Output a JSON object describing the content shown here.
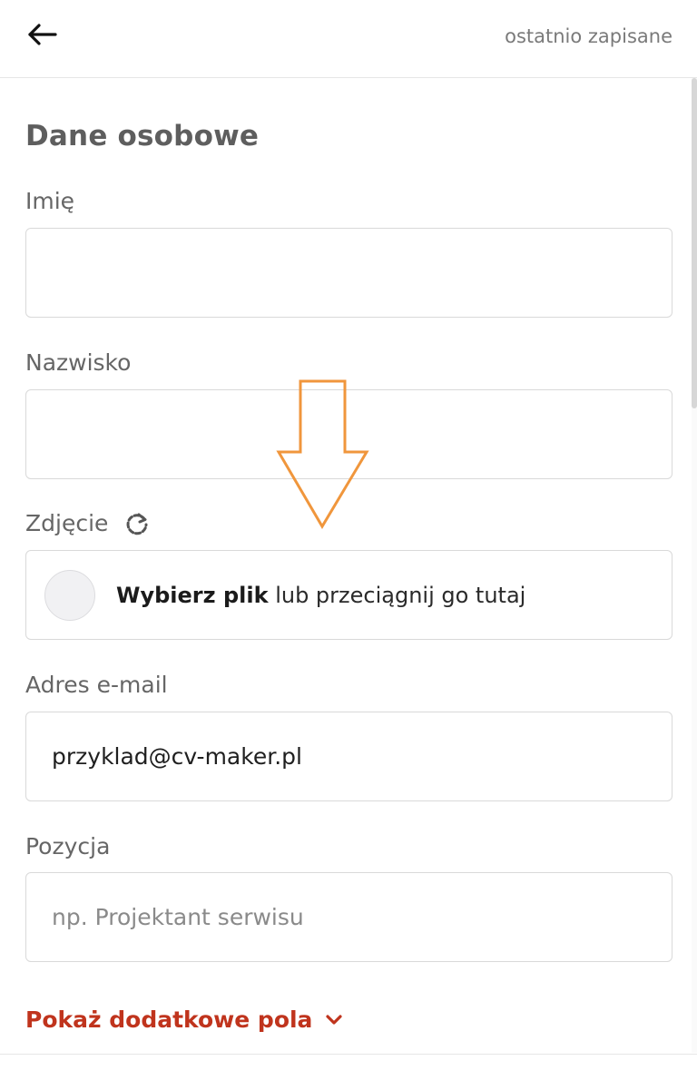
{
  "header": {
    "save_status": "ostatnio zapisane"
  },
  "section": {
    "title": "Dane osobowe"
  },
  "fields": {
    "first_name": {
      "label": "Imię",
      "value": "",
      "placeholder": ""
    },
    "last_name": {
      "label": "Nazwisko",
      "value": "",
      "placeholder": ""
    },
    "photo": {
      "label": "Zdjęcie",
      "choose_file": "Wybierz plik",
      "drag_text": " lub przeciągnij go tutaj"
    },
    "email": {
      "label": "Adres e-mail",
      "value": "przyklad@cv-maker.pl",
      "placeholder": ""
    },
    "position": {
      "label": "Pozycja",
      "value": "",
      "placeholder": "np. Projektant serwisu"
    }
  },
  "more_fields": {
    "label": "Pokaż dodatkowe pola"
  },
  "icons": {
    "back": "arrow-left-icon",
    "refresh": "refresh-icon",
    "chevron": "chevron-down-icon"
  },
  "colors": {
    "accent": "#c0341d",
    "annotation_arrow": "#f0963c",
    "title": "#5e5e5e",
    "label": "#666666",
    "border": "#d9d9d9"
  }
}
